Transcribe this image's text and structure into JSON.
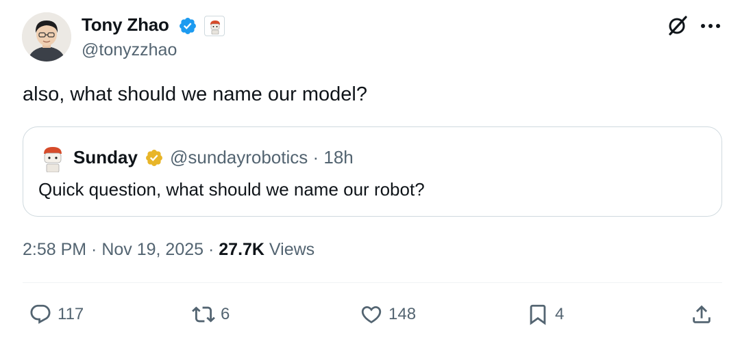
{
  "author": {
    "name": "Tony Zhao",
    "handle": "@tonyzzhao",
    "verified_color": "#1d9bf0"
  },
  "tweet": {
    "text": "also, what should we name our model?"
  },
  "quoted_tweet": {
    "author_name": "Sunday",
    "handle_time": "@sundayrobotics · 18h",
    "text": "Quick question, what should we name our robot?",
    "verified_color": "#e8b528"
  },
  "meta": {
    "time_date": "2:58 PM · Nov 19, 2025 · ",
    "views_count": "27.7K",
    "views_label": " Views"
  },
  "actions": {
    "replies": "117",
    "reposts": "6",
    "likes": "148",
    "bookmarks": "4"
  },
  "icons": [
    "grok-icon",
    "more-icon",
    "reply-icon",
    "repost-icon",
    "like-icon",
    "bookmark-icon",
    "share-icon"
  ],
  "colors": {
    "text_primary": "#0f1419",
    "text_secondary": "#536471",
    "border": "#cfd9de"
  }
}
